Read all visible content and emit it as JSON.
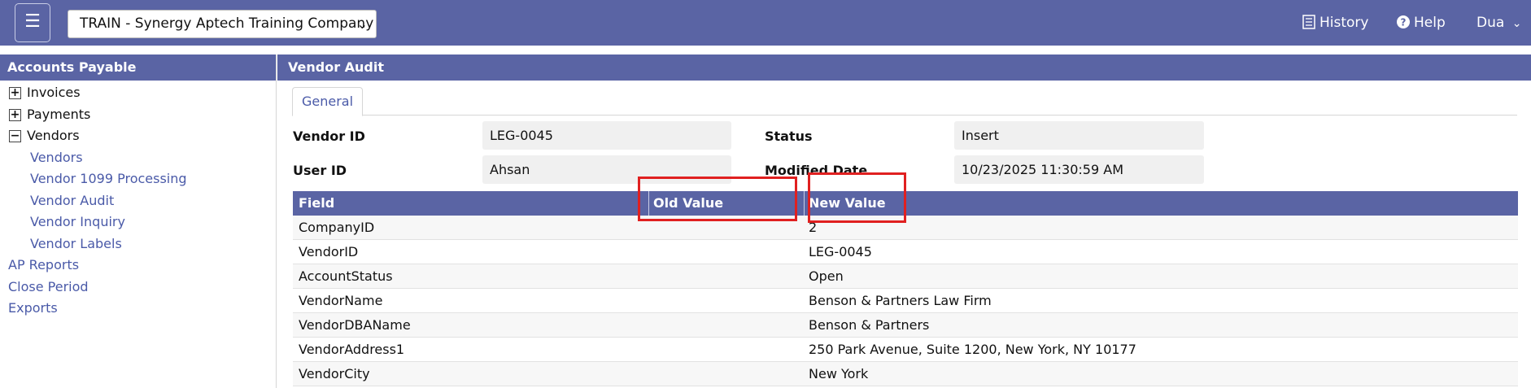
{
  "topbar": {
    "menu_icon": "hamburger-menu-icon",
    "company": "TRAIN - Synergy Aptech Training Company",
    "history_label": "History",
    "help_label": "Help",
    "user_label": "Dua",
    "accent_color": "#5a64a4"
  },
  "sidebar": {
    "title": "Accounts Payable",
    "tree": [
      {
        "label": "Invoices",
        "toggle": "+"
      },
      {
        "label": "Payments",
        "toggle": "+"
      },
      {
        "label": "Vendors",
        "toggle": "−"
      }
    ],
    "vendor_children": [
      "Vendors",
      "Vendor 1099 Processing",
      "Vendor Audit",
      "Vendor Inquiry",
      "Vendor Labels"
    ],
    "other_items": [
      "AP Reports",
      "Close Period",
      "Exports"
    ]
  },
  "main": {
    "title": "Vendor Audit",
    "tab": "General",
    "vendor_id_label": "Vendor ID",
    "vendor_id_value": "LEG-0045",
    "status_label": "Status",
    "status_value": "Insert",
    "user_id_label": "User ID",
    "user_id_value": "Ahsan",
    "modified_date_label": "Modified Date",
    "modified_date_value": "10/23/2025 11:30:59 AM"
  },
  "table": {
    "headers": [
      "Field",
      "Old Value",
      "New Value"
    ],
    "rows": [
      {
        "field": "CompanyID",
        "old": "",
        "new": "2"
      },
      {
        "field": "VendorID",
        "old": "",
        "new": "LEG-0045"
      },
      {
        "field": "AccountStatus",
        "old": "",
        "new": "Open"
      },
      {
        "field": "VendorName",
        "old": "",
        "new": "Benson & Partners Law Firm"
      },
      {
        "field": "VendorDBAName",
        "old": "",
        "new": "Benson & Partners"
      },
      {
        "field": "VendorAddress1",
        "old": "",
        "new": "250 Park Avenue, Suite 1200, New York, NY 10177"
      },
      {
        "field": "VendorCity",
        "old": "",
        "new": "New York"
      }
    ]
  },
  "highlight_color": "#e02020"
}
